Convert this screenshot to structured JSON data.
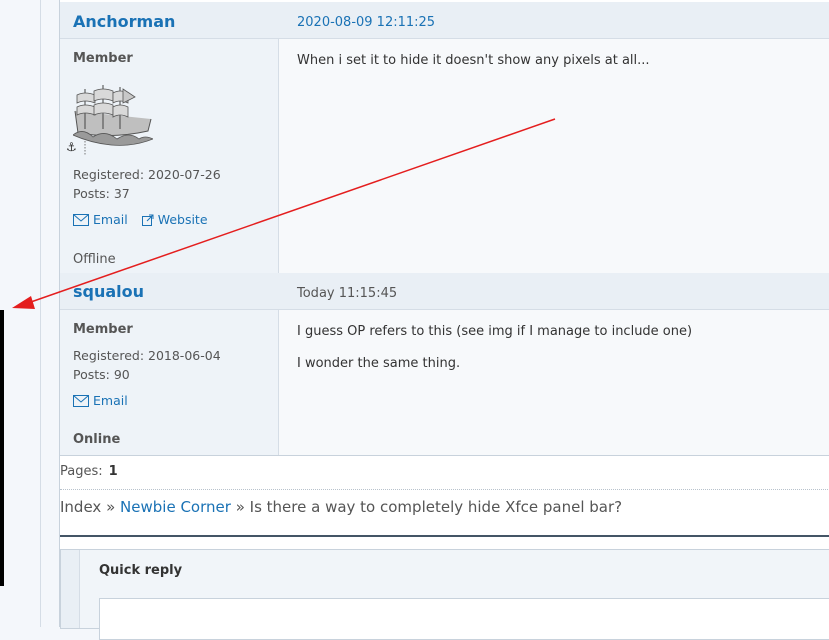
{
  "posts": [
    {
      "author": "Anchorman",
      "date": "2020-08-09 12:11:25",
      "role": "Member",
      "registered": "Registered: 2020-07-26",
      "posts": "Posts: 37",
      "email_label": "Email",
      "website_label": "Website",
      "status": "Offline",
      "message": "When i set it to hide it doesn't show any pixels at all..."
    },
    {
      "author": "squalou",
      "date": "Today 11:15:45",
      "role": "Member",
      "registered": "Registered: 2018-06-04",
      "posts": "Posts: 90",
      "email_label": "Email",
      "status": "Online",
      "message_lines": [
        "I guess OP refers to this (see img if I manage to include one)",
        "I wonder the same thing."
      ]
    }
  ],
  "pagination": {
    "label": "Pages:",
    "current": "1"
  },
  "breadcrumb": {
    "index": "Index",
    "sep": "»",
    "forum": "Newbie Corner",
    "topic": "Is there a way to completely hide Xfce panel bar?"
  },
  "quick_reply": {
    "title": "Quick reply"
  },
  "colors": {
    "link": "#1a72b5",
    "annotation_arrow": "#e41e1e"
  }
}
